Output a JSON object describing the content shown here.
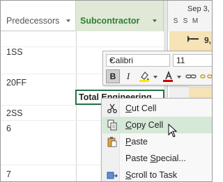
{
  "columns": {
    "predecessors": "Predecessors",
    "subcontractor": "Subcontractor"
  },
  "gantt": {
    "week_label": "Sep 3,",
    "days": [
      "S",
      "S",
      "M"
    ],
    "summary_value": "9,"
  },
  "rows": [
    {
      "pred": "1SS"
    },
    {
      "pred": "20FF"
    },
    {
      "pred": "2SS"
    },
    {
      "pred": "6"
    },
    {
      "pred": "7"
    }
  ],
  "selected_cell": {
    "text": "Total Engineering"
  },
  "mini_toolbar": {
    "font_name": "Calibri",
    "font_size": "11",
    "bold": "B",
    "italic": "I",
    "highlight_color": "#ffe500",
    "font_color": "#d00000"
  },
  "context_menu": {
    "items": [
      {
        "prefix": "",
        "hotkey": "C",
        "rest": "ut Cell",
        "icon": "scissors-icon"
      },
      {
        "prefix": "",
        "hotkey": "C",
        "rest": "opy Cell",
        "icon": "copy-icon",
        "highlighted": true
      },
      {
        "prefix": "",
        "hotkey": "P",
        "rest": "aste",
        "icon": "clipboard-icon"
      },
      {
        "prefix": "Paste ",
        "hotkey": "S",
        "rest": "pecial...",
        "icon": ""
      },
      {
        "prefix": "",
        "hotkey": "S",
        "rest": "croll to Task",
        "icon": "scroll-to-task-icon"
      }
    ]
  },
  "colors": {
    "accent_green": "#217346",
    "header_green": "#2e7d32",
    "menu_hover": "#d6e8d8"
  }
}
